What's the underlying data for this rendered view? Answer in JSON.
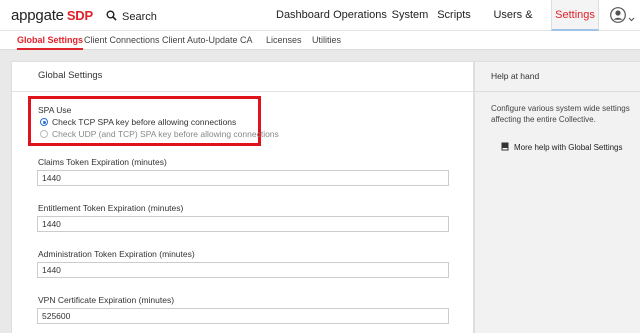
{
  "app": {
    "logo_text": "appgate",
    "logo_suffix": "SDP"
  },
  "search": {
    "label": "Search"
  },
  "nav": {
    "items": [
      "Dashboard",
      "Operations",
      "System",
      "Scripts",
      "Users & Devices",
      "Settings"
    ],
    "active": "Settings"
  },
  "subnav": {
    "items": [
      "Global Settings",
      "Client Connections",
      "Client Auto-Update",
      "CA",
      "Licenses",
      "Utilities"
    ],
    "active": "Global Settings"
  },
  "main": {
    "title": "Global Settings",
    "spa": {
      "label": "SPA Use",
      "options": [
        {
          "label": "Check TCP SPA key before allowing connections",
          "checked": true
        },
        {
          "label": "Check UDP (and TCP) SPA key before allowing connections",
          "checked": false
        }
      ]
    },
    "fields": [
      {
        "label": "Claims Token Expiration (minutes)",
        "value": "1440"
      },
      {
        "label": "Entitlement Token Expiration (minutes)",
        "value": "1440"
      },
      {
        "label": "Administration Token Expiration (minutes)",
        "value": "1440"
      },
      {
        "label": "VPN Certificate Expiration (minutes)",
        "value": "525600"
      }
    ]
  },
  "help": {
    "title": "Help at hand",
    "text": "Configure various system wide settings affecting the entire Collective.",
    "link": "More help with Global Settings"
  },
  "colors": {
    "brand_red": "#e0222a",
    "highlight_red": "#e0121b",
    "radio_blue": "#2a6fd6"
  }
}
